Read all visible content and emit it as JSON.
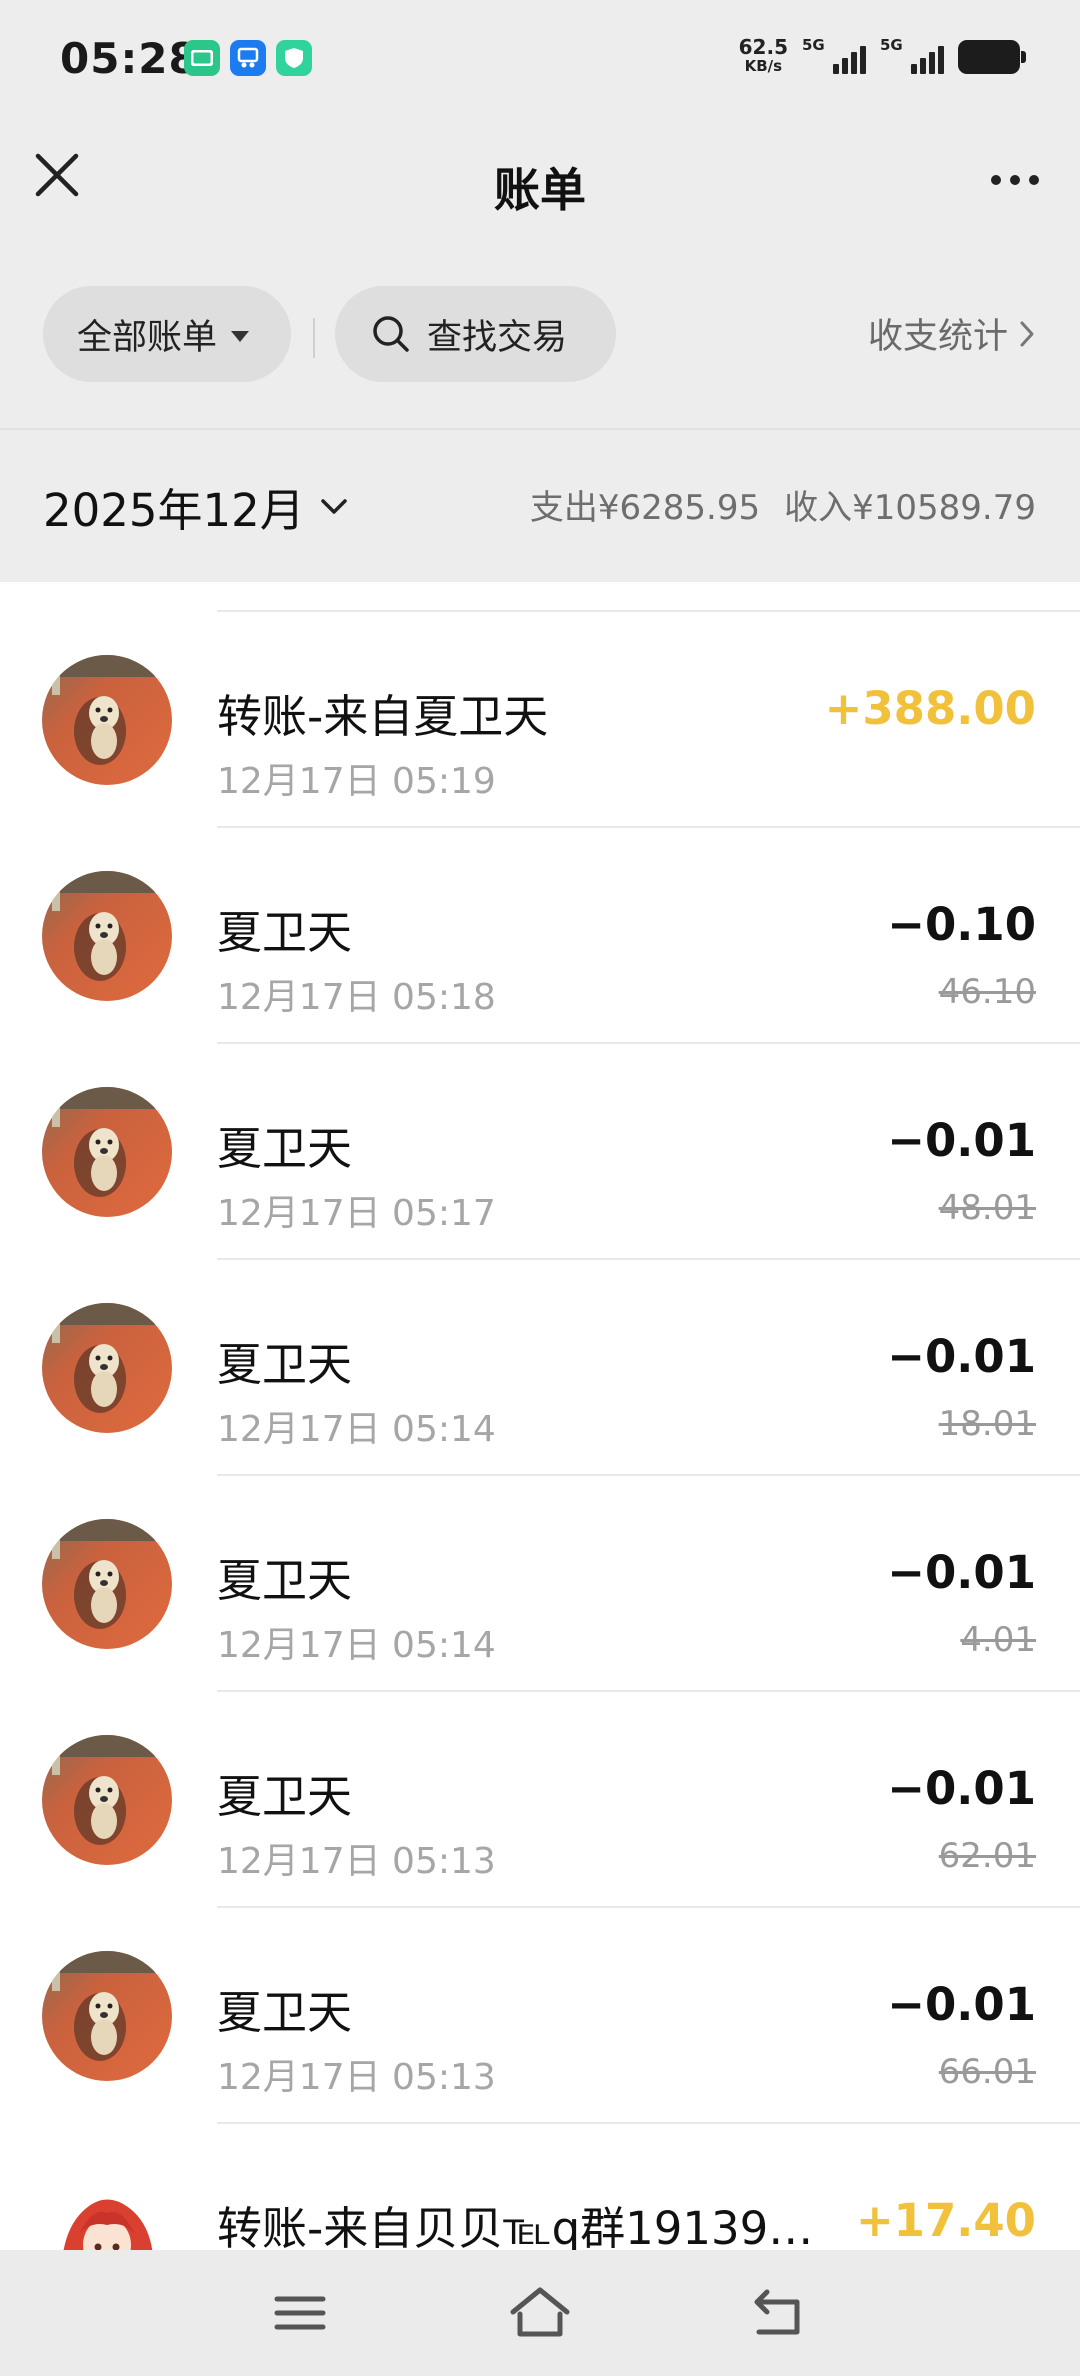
{
  "status": {
    "time": "05:28",
    "net_speed": "62.5",
    "net_unit": "KB/s",
    "sim1": "5G",
    "sim2": "5G",
    "app_icon_colors": [
      "#2bc78a",
      "#1d7bf0",
      "#2fd39b"
    ]
  },
  "nav": {
    "title": "账单",
    "close_icon": "close-icon",
    "more_icon": "more-icon"
  },
  "filters": {
    "all_bills": "全部账单",
    "search": "查找交易",
    "stats": "收支统计"
  },
  "month": {
    "label": "2025年12月",
    "expense": "支出¥6285.95",
    "income": "收入¥10589.79"
  },
  "colors": {
    "income_amount": "#f2c13c",
    "background": "#ededed"
  },
  "transactions": [
    {
      "title": "转账-来自夏卫天",
      "time": "12月17日 05:19",
      "amount": "+388.00",
      "balance": "",
      "type": "income",
      "avatar": "dog-photo"
    },
    {
      "title": "夏卫天",
      "time": "12月17日 05:18",
      "amount": "−0.10",
      "balance": "46.10",
      "type": "expense",
      "avatar": "dog-photo"
    },
    {
      "title": "夏卫天",
      "time": "12月17日 05:17",
      "amount": "−0.01",
      "balance": "48.01",
      "type": "expense",
      "avatar": "dog-photo"
    },
    {
      "title": "夏卫天",
      "time": "12月17日 05:14",
      "amount": "−0.01",
      "balance": "18.01",
      "type": "expense",
      "avatar": "dog-photo"
    },
    {
      "title": "夏卫天",
      "time": "12月17日 05:14",
      "amount": "−0.01",
      "balance": "4.01",
      "type": "expense",
      "avatar": "dog-photo"
    },
    {
      "title": "夏卫天",
      "time": "12月17日 05:13",
      "amount": "−0.01",
      "balance": "62.01",
      "type": "expense",
      "avatar": "dog-photo"
    },
    {
      "title": "夏卫天",
      "time": "12月17日 05:13",
      "amount": "−0.01",
      "balance": "66.01",
      "type": "expense",
      "avatar": "dog-photo"
    },
    {
      "title": "转账-来自贝贝℡q群191390…",
      "time": "",
      "amount": "+17.40",
      "balance": "",
      "type": "income",
      "avatar": "anime-girl"
    }
  ],
  "bottom_nav": [
    "menu-icon",
    "home-icon",
    "back-icon"
  ]
}
